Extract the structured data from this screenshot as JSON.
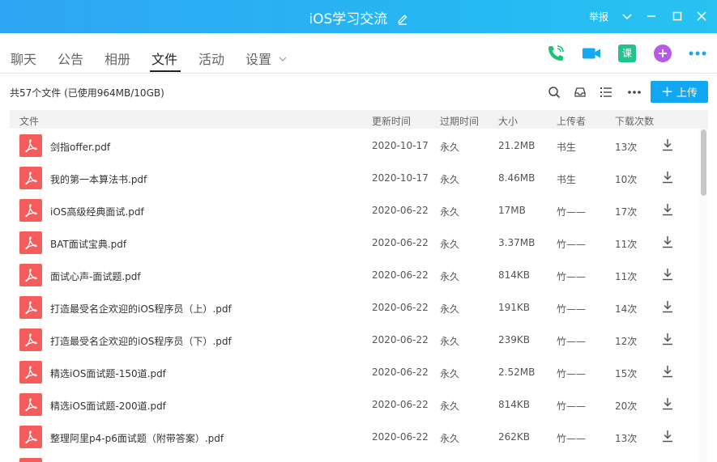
{
  "window": {
    "title": "iOS学习交流",
    "report_label": "举报"
  },
  "tabs": [
    {
      "label": "聊天"
    },
    {
      "label": "公告"
    },
    {
      "label": "相册"
    },
    {
      "label": "文件"
    },
    {
      "label": "活动"
    },
    {
      "label": "设置"
    }
  ],
  "active_tab": "文件",
  "app_icons": {
    "course_label": "课"
  },
  "toolbar": {
    "file_count": "共57个文件 (已使用964MB/10GB)",
    "upload_label": "上传"
  },
  "columns": [
    "文件",
    "更新时间",
    "过期时间",
    "大小",
    "上传者",
    "下载次数"
  ],
  "files": [
    {
      "name": "剑指offer.pdf",
      "updated": "2020-10-17",
      "expires": "永久",
      "size": "21.2MB",
      "uploader": "书生",
      "downloads": "13次"
    },
    {
      "name": "我的第一本算法书.pdf",
      "updated": "2020-10-17",
      "expires": "永久",
      "size": "8.46MB",
      "uploader": "书生",
      "downloads": "10次"
    },
    {
      "name": "iOS高级经典面试.pdf",
      "updated": "2020-06-22",
      "expires": "永久",
      "size": "17MB",
      "uploader": "竹——",
      "downloads": "17次"
    },
    {
      "name": "BAT面试宝典.pdf",
      "updated": "2020-06-22",
      "expires": "永久",
      "size": "3.37MB",
      "uploader": "竹——",
      "downloads": "11次"
    },
    {
      "name": "面试心声-面试题.pdf",
      "updated": "2020-06-22",
      "expires": "永久",
      "size": "814KB",
      "uploader": "竹——",
      "downloads": "11次"
    },
    {
      "name": "打造最受名企欢迎的iOS程序员（上）.pdf",
      "updated": "2020-06-22",
      "expires": "永久",
      "size": "191KB",
      "uploader": "竹——",
      "downloads": "14次"
    },
    {
      "name": "打造最受名企欢迎的iOS程序员（下）.pdf",
      "updated": "2020-06-22",
      "expires": "永久",
      "size": "239KB",
      "uploader": "竹——",
      "downloads": "12次"
    },
    {
      "name": "精选iOS面试题-150道.pdf",
      "updated": "2020-06-22",
      "expires": "永久",
      "size": "2.52MB",
      "uploader": "竹——",
      "downloads": "15次"
    },
    {
      "name": "精选iOS面试题-200道.pdf",
      "updated": "2020-06-22",
      "expires": "永久",
      "size": "814KB",
      "uploader": "竹——",
      "downloads": "20次"
    },
    {
      "name": "整理阿里p4-p6面试题（附带答案）.pdf",
      "updated": "2020-06-22",
      "expires": "永久",
      "size": "262KB",
      "uploader": "竹——",
      "downloads": "13次"
    },
    {
      "name": "",
      "updated": "",
      "expires": "",
      "size": "",
      "uploader": "",
      "downloads": ""
    }
  ],
  "colors": {
    "titlebar": "#26b6f3",
    "accent": "#12a7f3",
    "pdf": "#f55c5c",
    "call_green": "#1fc27a",
    "video_blue": "#17a8f0",
    "plus_purple": "#b55be6"
  }
}
